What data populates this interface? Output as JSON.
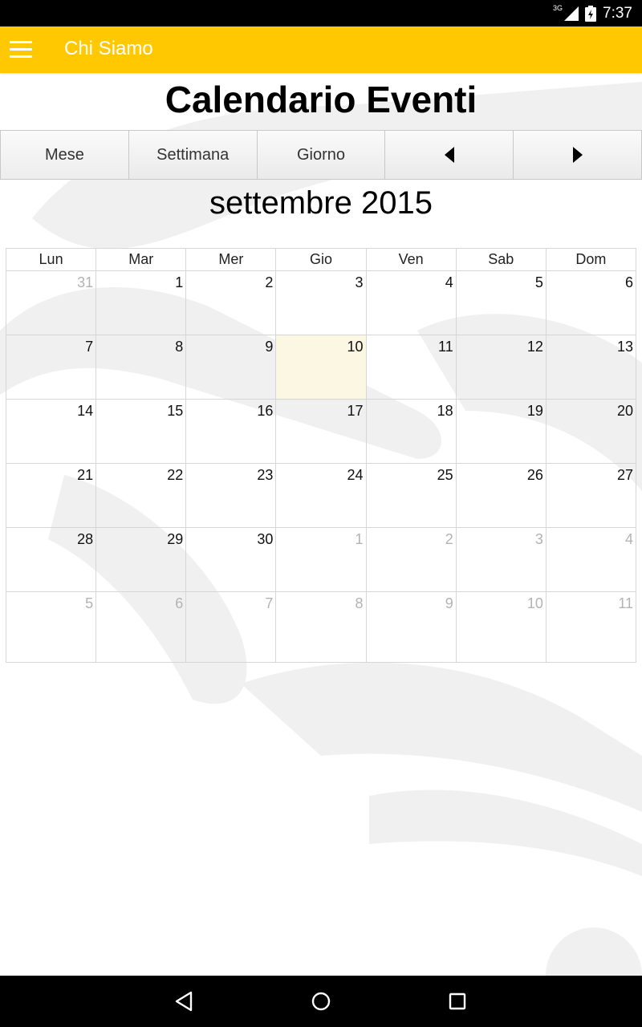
{
  "status_bar": {
    "network": "3G",
    "time": "7:37",
    "icons": [
      "signal-icon",
      "battery-icon"
    ]
  },
  "app_bar": {
    "title": "Chi Siamo",
    "menu_icon": "hamburger-menu-icon",
    "background_color": "#ffc800"
  },
  "page": {
    "title": "Calendario Eventi"
  },
  "toolbar": {
    "month_label": "Mese",
    "week_label": "Settimana",
    "day_label": "Giorno",
    "prev_icon": "triangle-left-icon",
    "next_icon": "triangle-right-icon"
  },
  "calendar": {
    "month_title": "settembre 2015",
    "weekdays": [
      "Lun",
      "Mar",
      "Mer",
      "Gio",
      "Ven",
      "Sab",
      "Dom"
    ],
    "today_color": "#fcf7e2",
    "weeks": [
      [
        "31",
        "1",
        "2",
        "3",
        "4",
        "5",
        "6"
      ],
      [
        "7",
        "8",
        "9",
        "10",
        "11",
        "12",
        "13"
      ],
      [
        "14",
        "15",
        "16",
        "17",
        "18",
        "19",
        "20"
      ],
      [
        "21",
        "22",
        "23",
        "24",
        "25",
        "26",
        "27"
      ],
      [
        "28",
        "29",
        "30",
        "1",
        "2",
        "3",
        "4"
      ],
      [
        "5",
        "6",
        "7",
        "8",
        "9",
        "10",
        "11"
      ]
    ]
  },
  "nav_bar": {
    "back_icon": "back-triangle-icon",
    "home_icon": "home-circle-icon",
    "recents_icon": "recents-square-icon"
  }
}
